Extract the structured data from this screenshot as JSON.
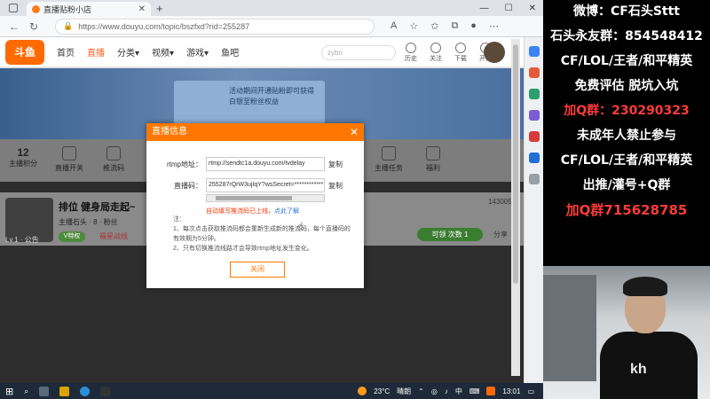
{
  "browser": {
    "tab_title": "直播贴粉小店",
    "url": "https://www.douyu.com/topic/bszfxd?rid=255287",
    "new_tab": "+",
    "controls": {
      "minimize": "—",
      "maximize": "☐",
      "close": "✕"
    }
  },
  "site": {
    "logo": "斗鱼",
    "nav": [
      "首页",
      "直播",
      "分类▾",
      "视频▾",
      "游戏▾",
      "鱼吧"
    ],
    "search_placeholder": "zybn",
    "right_items": [
      "历史",
      "关注",
      "下载",
      "开播"
    ]
  },
  "page": {
    "promo_text": "活动期间开通贴粉即可获得白银至粉丝权益",
    "stat_number": "12",
    "stat_label": "主播积分",
    "tools": [
      "直播开关",
      "推流码",
      "主播任务",
      "福利"
    ],
    "room_title": "排位 健身局走起~",
    "room_meta": "主播石头 · 8",
    "room_fans": "粉丝",
    "room_level": "Lv.1 · 公告",
    "tag1": "V特权",
    "tag2": "福星战线",
    "room_id": "143005",
    "follow": "可领 次数 1",
    "share": "分享"
  },
  "modal": {
    "title": "直播信息",
    "close": "✕",
    "rtmp_label": "rtmp地址：",
    "rtmp_value": "rtmp://sendtc1a.douyu.com/tvdelay",
    "code_label": "直播码：",
    "code_value": "255287rQrW3ujIqY?wsSecret=************",
    "copy": "复制",
    "warning": "自动填写推流码已上线，",
    "warning_link": "点此了解",
    "notes_title": "注：",
    "note1": "1、每次点击获取推流码都会重新生成新的推流码，每个直播码的有效期为5分钟。",
    "note2": "2、只有切换推流线路才会导致rtmp地址发生变化。",
    "button": "关闭"
  },
  "taskbar": {
    "temperature": "23°C",
    "weather": "晴朗",
    "lang": "中",
    "time": "13:01"
  },
  "overlay": {
    "lines": [
      {
        "text": "微博：CF石头Sttt",
        "color": "#ffffff"
      },
      {
        "text": "石头永友群：854548412",
        "color": "#ffffff"
      },
      {
        "text": "CF/LOL/王者/和平精英",
        "color": "#ffffff"
      },
      {
        "text": "免费评估 脱坑入坑",
        "color": "#ffffff"
      },
      {
        "text": "加Q群：230290323",
        "color": "#ff3b3b"
      },
      {
        "text": "未成年人禁止参与",
        "color": "#ffffff"
      },
      {
        "text": "CF/LOL/王者/和平精英",
        "color": "#ffffff"
      },
      {
        "text": "出推/灌号+Q群",
        "color": "#ffffff"
      },
      {
        "text": "加Q群715628785",
        "color": "#ff3b3b"
      }
    ]
  },
  "camera": {
    "shirt_text": "kh"
  }
}
